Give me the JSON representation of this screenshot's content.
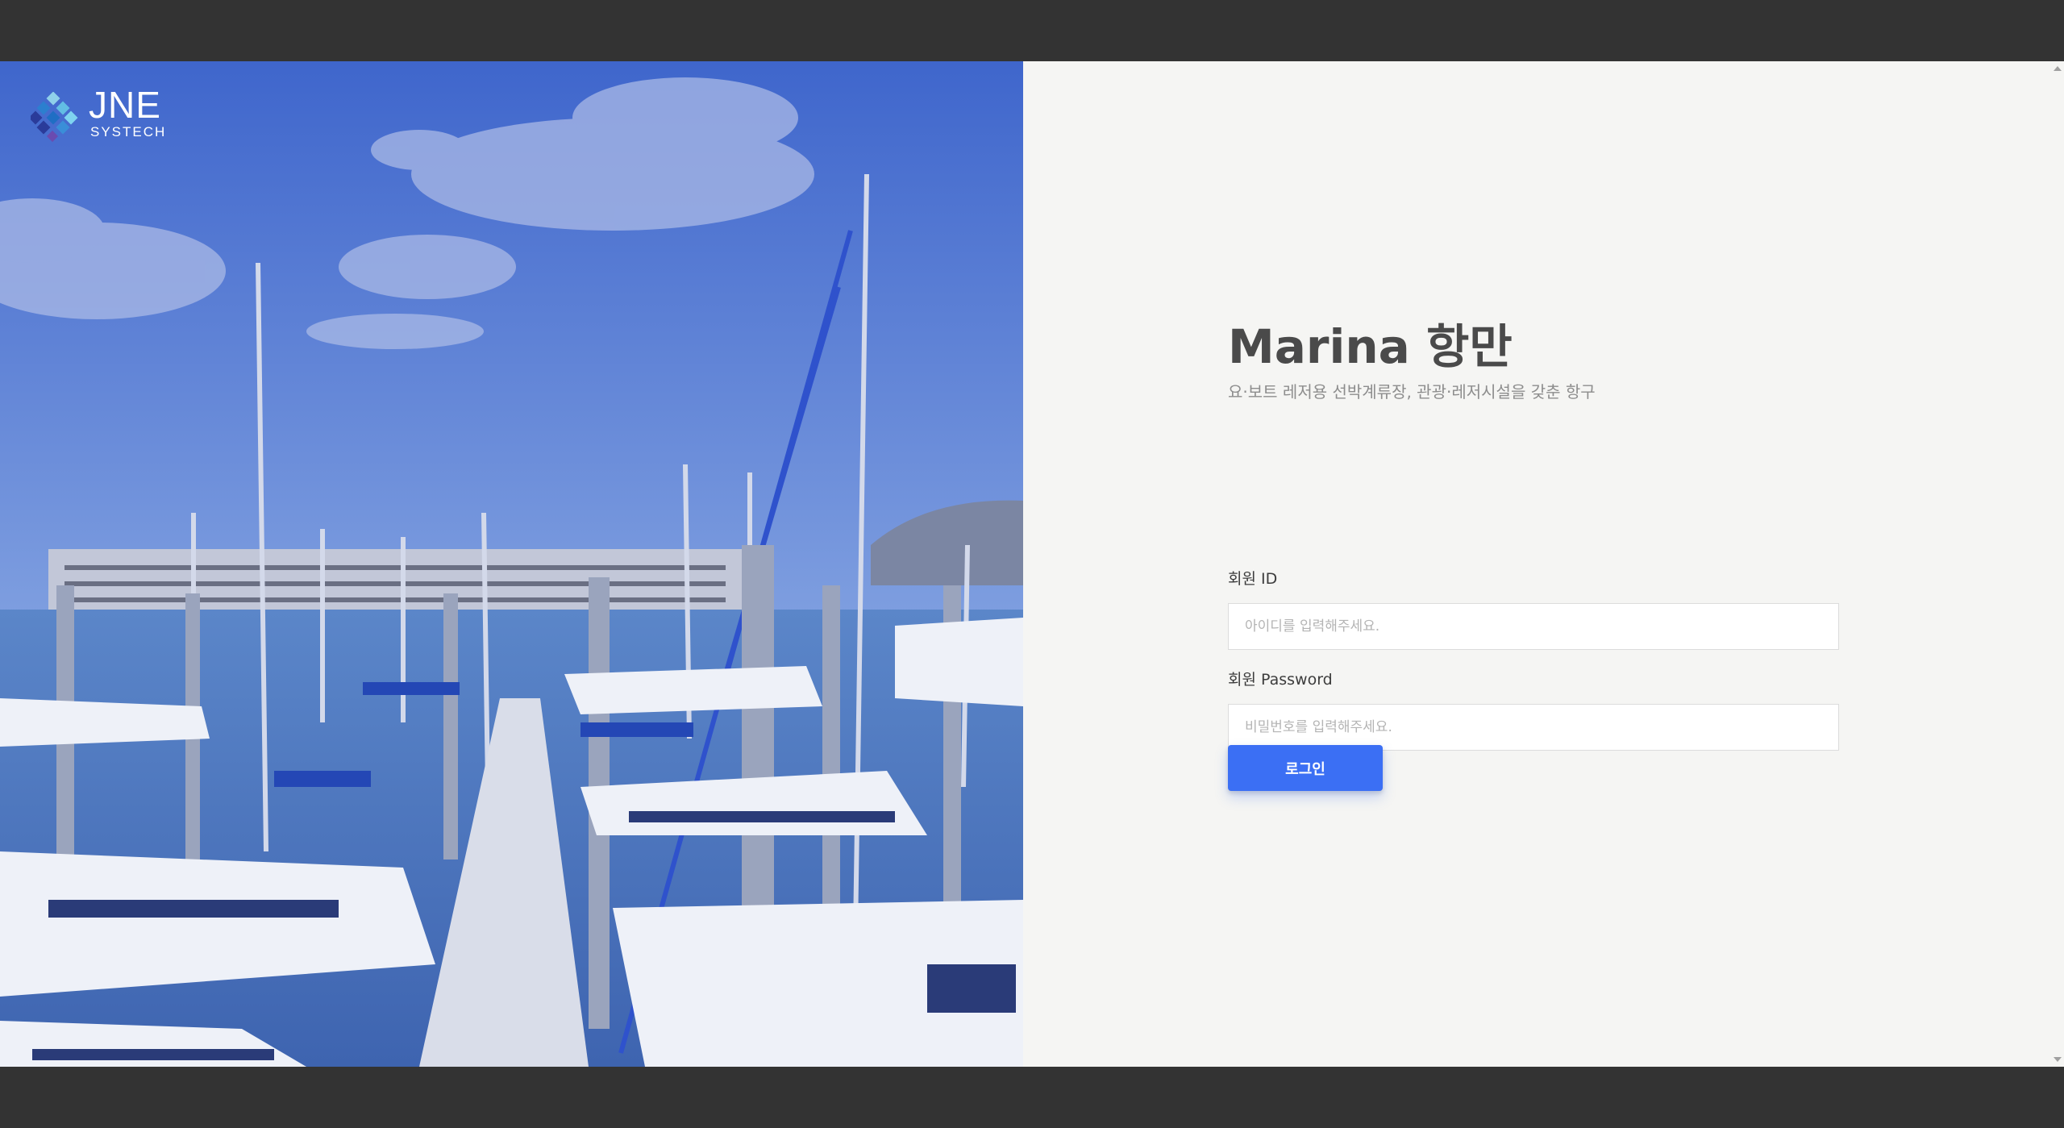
{
  "brand": {
    "logo_main": "JNE",
    "logo_sub": "SYSTECH"
  },
  "hero": {
    "image": "marina-harbor-photo",
    "overlay_color": "#3a5fd0"
  },
  "login": {
    "title": "Marina 항만",
    "subtitle": "요·보트 레저용 선박계류장, 관광·레저시설을 갖춘 항구",
    "id_label": "회원 ID",
    "id_placeholder": "아이디를 입력해주세요.",
    "password_label": "회원 Password",
    "password_placeholder": "비밀번호를 입력해주세요.",
    "submit_label": "로그인"
  },
  "colors": {
    "accent": "#3b6ff4",
    "chrome": "#333333",
    "panel_bg": "#f5f5f3",
    "title_text": "#4a4a4a"
  }
}
